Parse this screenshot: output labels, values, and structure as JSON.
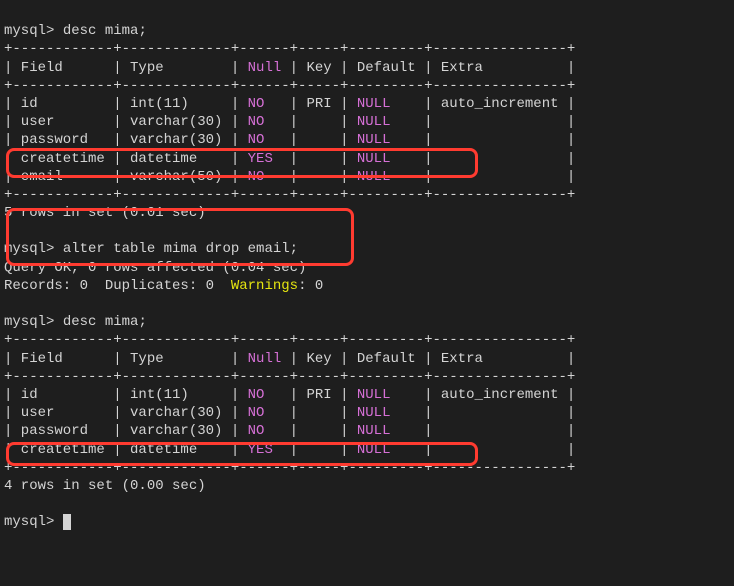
{
  "prompt": "mysql>",
  "cmd1": "desc mima;",
  "border_top": "+------------+-------------+------+-----+---------+----------------+",
  "header": "| Field      | Type        | Null | Key | Default | Extra          |",
  "t1": {
    "r1_a": "| id         | int(11)     | ",
    "r1_b": "NO",
    "r1_c": "   | PRI | ",
    "r1_d": "NULL",
    "r1_e": "    | auto_increment |",
    "r2_a": "| user       | varchar(30) | ",
    "r2_b": "NO",
    "r2_c": "   |     | ",
    "r2_d": "NULL",
    "r2_e": "    |                |",
    "r3_a": "| password   | varchar(30) | ",
    "r3_b": "NO",
    "r3_c": "   |     | ",
    "r3_d": "NULL",
    "r3_e": "    |                |",
    "r4_a": "| createtime | datetime    | ",
    "r4_b": "YES",
    "r4_c": "  |     | ",
    "r4_d": "NULL",
    "r4_e": "    |                |",
    "r5_a": "| email      | varchar(50) | ",
    "r5_b": "NO",
    "r5_c": "   |     | ",
    "r5_d": "NULL",
    "r5_e": "    |                |"
  },
  "result1": "5 rows in set (0.01 sec)",
  "cmd2": "alter table mima drop email;",
  "ok_line": "Query OK, 0 rows affected (0.04 sec)",
  "records_a": "Records: 0  Duplicates: 0  ",
  "records_b": "Warnings",
  "records_c": ": 0",
  "cmd3": "desc mima;",
  "t2": {
    "r1_a": "| id         | int(11)     | ",
    "r1_b": "NO",
    "r1_c": "   | PRI | ",
    "r1_d": "NULL",
    "r1_e": "    | auto_increment |",
    "r2_a": "| user       | varchar(30) | ",
    "r2_b": "NO",
    "r2_c": "   |     | ",
    "r2_d": "NULL",
    "r2_e": "    |                |",
    "r3_a": "| password   | varchar(30) | ",
    "r3_b": "NO",
    "r3_c": "   |     | ",
    "r3_d": "NULL",
    "r3_e": "    |                |",
    "r4_a": "| createtime | datetime    | ",
    "r4_b": "YES",
    "r4_c": "  |     | ",
    "r4_d": "NULL",
    "r4_e": "    |                |"
  },
  "result2": "4 rows in set (0.00 sec)",
  "tables_meta": {
    "columns": [
      "Field",
      "Type",
      "Null",
      "Key",
      "Default",
      "Extra"
    ],
    "before": [
      {
        "Field": "id",
        "Type": "int(11)",
        "Null": "NO",
        "Key": "PRI",
        "Default": "NULL",
        "Extra": "auto_increment"
      },
      {
        "Field": "user",
        "Type": "varchar(30)",
        "Null": "NO",
        "Key": "",
        "Default": "NULL",
        "Extra": ""
      },
      {
        "Field": "password",
        "Type": "varchar(30)",
        "Null": "NO",
        "Key": "",
        "Default": "NULL",
        "Extra": ""
      },
      {
        "Field": "createtime",
        "Type": "datetime",
        "Null": "YES",
        "Key": "",
        "Default": "NULL",
        "Extra": ""
      },
      {
        "Field": "email",
        "Type": "varchar(50)",
        "Null": "NO",
        "Key": "",
        "Default": "NULL",
        "Extra": ""
      }
    ],
    "after": [
      {
        "Field": "id",
        "Type": "int(11)",
        "Null": "NO",
        "Key": "PRI",
        "Default": "NULL",
        "Extra": "auto_increment"
      },
      {
        "Field": "user",
        "Type": "varchar(30)",
        "Null": "NO",
        "Key": "",
        "Default": "NULL",
        "Extra": ""
      },
      {
        "Field": "password",
        "Type": "varchar(30)",
        "Null": "NO",
        "Key": "",
        "Default": "NULL",
        "Extra": ""
      },
      {
        "Field": "createtime",
        "Type": "datetime",
        "Null": "YES",
        "Key": "",
        "Default": "NULL",
        "Extra": ""
      }
    ]
  }
}
